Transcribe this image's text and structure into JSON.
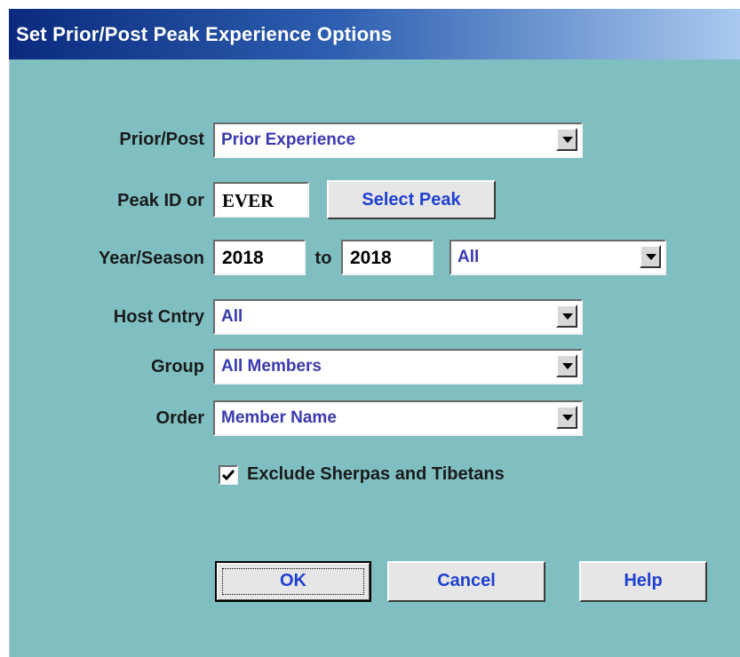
{
  "window": {
    "title": "Set Prior/Post Peak Experience Options"
  },
  "form": {
    "prior_post": {
      "label": "Prior/Post",
      "value": "Prior Experience"
    },
    "peak_id": {
      "label": "Peak ID or",
      "value": "EVER",
      "select_button": "Select Peak"
    },
    "year_season": {
      "label": "Year/Season",
      "from": "2018",
      "to_label": "to",
      "to": "2018",
      "season": "All"
    },
    "host_cntry": {
      "label": "Host Cntry",
      "value": "All"
    },
    "group": {
      "label": "Group",
      "value": "All Members"
    },
    "order": {
      "label": "Order",
      "value": "Member Name"
    },
    "exclude_sherpas": {
      "label": "Exclude Sherpas and Tibetans",
      "checked": true
    }
  },
  "buttons": {
    "ok": "OK",
    "cancel": "Cancel",
    "help": "Help"
  },
  "icons": {
    "dropdown": "chevron-down-icon",
    "check": "checkmark-icon"
  },
  "colors": {
    "background": "#7fbfc2",
    "title_start": "#0a2a7e",
    "title_end": "#a9c9ee",
    "value_text": "#3a3ab0",
    "button_text": "#1f3fd0"
  }
}
